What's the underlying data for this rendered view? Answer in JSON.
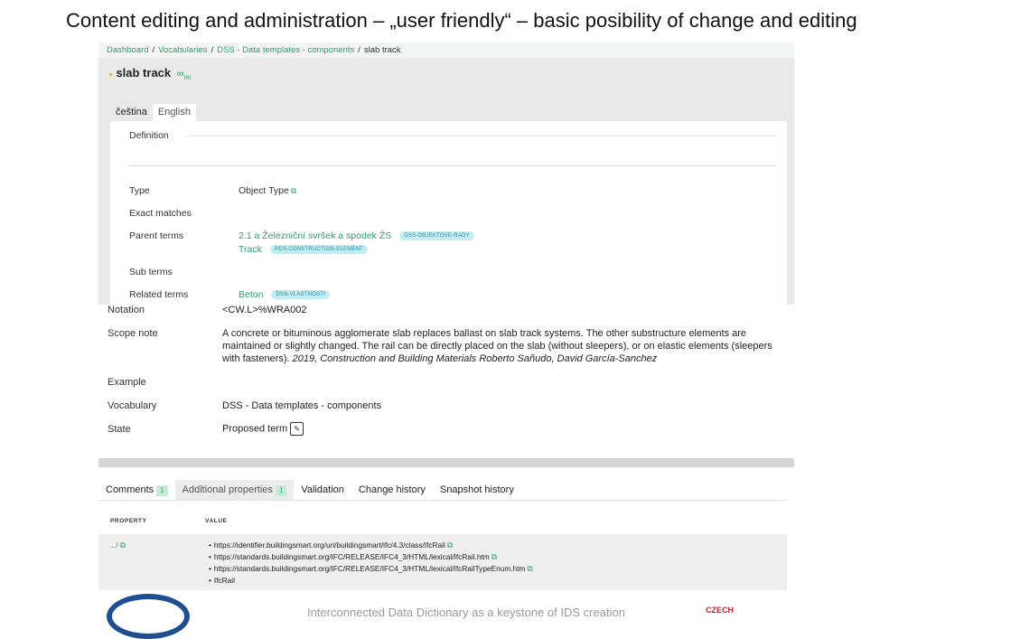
{
  "slide": {
    "title": "Content editing and administration – „user friendly“ – basic posibility of change and editing",
    "footer": "Interconnected Data Dictionary as a keystone of IDS creation",
    "logo_right_text": "CZECH"
  },
  "breadcrumb": [
    "Dashboard",
    "Vocabularies",
    "DSS - Data templates - components",
    "slab track"
  ],
  "term": {
    "title": "slab track",
    "iri": "IRI"
  },
  "language_tabs": [
    "čeština",
    "English"
  ],
  "fields": {
    "definition_label": "Definition",
    "type_label": "Type",
    "type_value": "Object Type",
    "exact_matches_label": "Exact matches",
    "parent_terms_label": "Parent terms",
    "parent_terms": [
      {
        "name": "2.1 a Železniční svršek a spodek ŽS",
        "badge": "DSS-OBJEKTOVE-RADY"
      },
      {
        "name": "Track",
        "badge": "RDS-CONSTRUCTION-ELEMENT"
      }
    ],
    "sub_terms_label": "Sub terms",
    "related_terms_label": "Related terms",
    "related_terms": [
      {
        "name": "Beton",
        "badge": "DSS-VLASTNOSTI"
      }
    ],
    "notation_label": "Notation",
    "notation_value": "<CW.L>%WRA002",
    "scope_note_label": "Scope note",
    "scope_note_text": "A concrete or bituminous agglomerate slab replaces ballast on slab track systems. The other substructure elements are maintained or slightly changed. The rail can be directly placed on the slab (without sleepers), or on elastic elements (sleepers with fasteners).",
    "scope_note_citation": "2019, Construction and Building Materials Roberto Sañudo, David García-Sanchez",
    "example_label": "Example",
    "vocabulary_label": "Vocabulary",
    "vocabulary_value": "DSS - Data templates - components",
    "state_label": "State",
    "state_value": "Proposed term"
  },
  "bottom_tabs": [
    {
      "label": "Comments",
      "count": "1"
    },
    {
      "label": "Additional properties",
      "count": "1"
    },
    {
      "label": "Validation"
    },
    {
      "label": "Change history"
    },
    {
      "label": "Snapshot history"
    }
  ],
  "properties_table": {
    "headers": [
      "PROPERTY",
      "VALUE"
    ],
    "row": {
      "property": ".../",
      "values": [
        "https://identifier.buildingsmart.org/uri/buildingsmart/ifc/4.3/class/IfcRail",
        "https://standards.buildingsmart.org/IFC/RELEASE/IFC4_3/HTML/lexical/IfcRail.htm",
        "https://standards.buildingsmart.org/IFC/RELEASE/IFC4_3/HTML/lexical/IfcRailTypeEnum.htm",
        "IfcRail"
      ]
    }
  },
  "colors": {
    "link": "#2aa36c",
    "badge_bg": "#c4ecf3",
    "badge_text": "#2a8fa3"
  },
  "icons": [
    "external-link-icon",
    "iri-icon",
    "edit-icon",
    "star-icon"
  ]
}
